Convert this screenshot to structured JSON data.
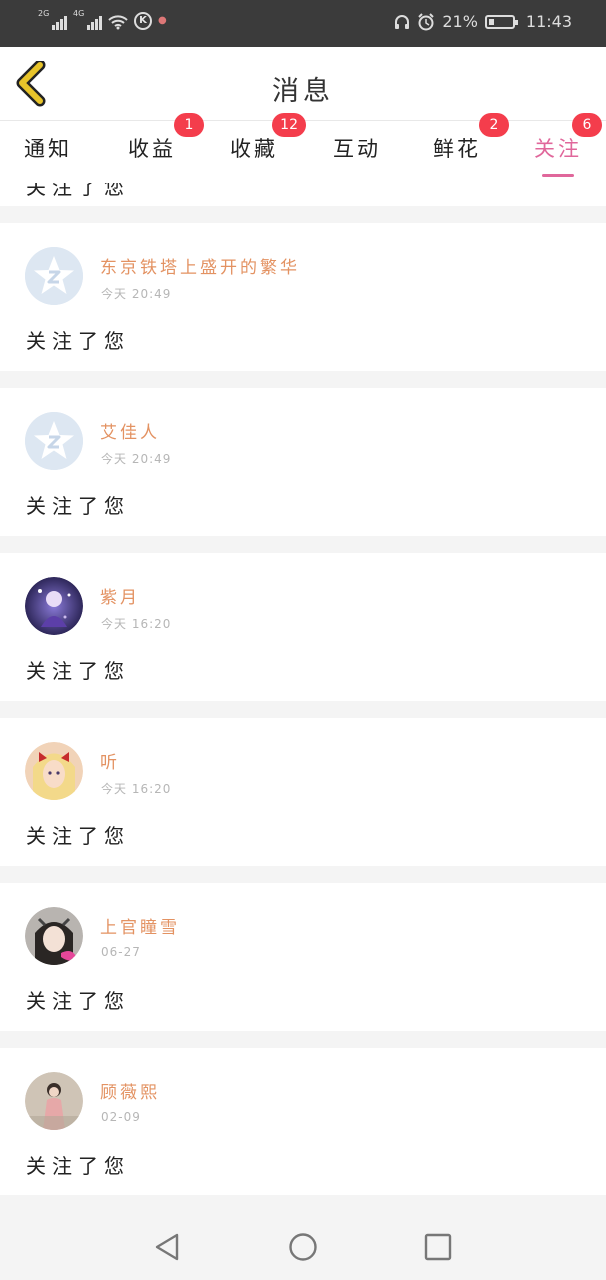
{
  "status_bar": {
    "sim1": "2G",
    "sim2": "4G",
    "battery_percent": "21%",
    "battery_level": 0.21,
    "time": "11:43",
    "icons": [
      "wifi-icon",
      "k-circle-icon",
      "notification-icon",
      "headphones-icon",
      "alarm-icon",
      "battery-icon"
    ]
  },
  "header": {
    "title": "消息",
    "back_icon": "chevron-left-icon",
    "accent_color": "#e8c42a"
  },
  "tabs": [
    {
      "label": "通知",
      "badge": "",
      "active": false
    },
    {
      "label": "收益",
      "badge": "1",
      "active": false
    },
    {
      "label": "收藏",
      "badge": "12",
      "active": false
    },
    {
      "label": "互动",
      "badge": "",
      "active": false
    },
    {
      "label": "鲜花",
      "badge": "2",
      "active": false
    },
    {
      "label": "关注",
      "badge": "6",
      "active": true
    }
  ],
  "colors": {
    "active_tab": "#e0679b",
    "badge": "#f43d4c",
    "username": "#e39262"
  },
  "partial_message": "关注了您",
  "items": [
    {
      "name": "东京铁塔上盛开的繁华",
      "time": "今天 20:49",
      "message": "关注了您",
      "avatar": "default-avatar-icon"
    },
    {
      "name": "艾佳人",
      "time": "今天 20:49",
      "message": "关注了您",
      "avatar": "default-avatar-icon"
    },
    {
      "name": "紫月",
      "time": "今天 16:20",
      "message": "关注了您",
      "avatar": "user-photo"
    },
    {
      "name": "听",
      "time": "今天 16:20",
      "message": "关注了您",
      "avatar": "user-photo"
    },
    {
      "name": "上官瞳雪",
      "time": "06-27",
      "message": "关注了您",
      "avatar": "user-photo"
    },
    {
      "name": "顾薇熙",
      "time": "02-09",
      "message": "关注了您",
      "avatar": "user-photo"
    }
  ],
  "navbar": {
    "icons": [
      "back-triangle-icon",
      "home-circle-icon",
      "recents-square-icon"
    ]
  }
}
